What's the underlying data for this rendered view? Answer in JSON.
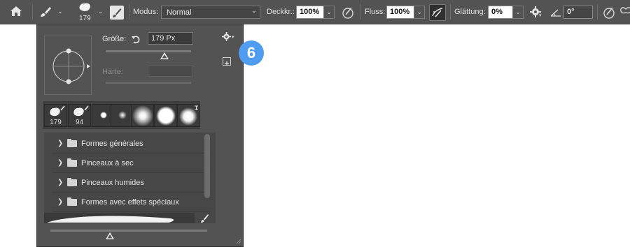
{
  "options_bar": {
    "mode_label": "Modus:",
    "mode_value": "Normal",
    "opacity_label": "Deckkr.:",
    "opacity_value": "100%",
    "flow_label": "Fluss:",
    "flow_value": "100%",
    "smoothing_label": "Glättung:",
    "smoothing_value": "0%",
    "angle_value": "0°",
    "brush_size_value": "179"
  },
  "brush_panel": {
    "size_label": "Größe:",
    "size_value": "179 Px",
    "hardness_label": "Härte:",
    "hardness_value": "",
    "recent_brushes": [
      {
        "label": "179"
      },
      {
        "label": "94"
      }
    ],
    "folders": [
      {
        "label": "Formes générales"
      },
      {
        "label": "Pinceaux à sec"
      },
      {
        "label": "Pinceaux humides"
      },
      {
        "label": "Formes avec effets spéciaux"
      }
    ]
  },
  "callout": {
    "number": "6"
  },
  "icons": [
    "home-icon",
    "brush-icon",
    "brush-settings-icon",
    "airbrush-icon",
    "pressure-opacity-icon",
    "gear-icon",
    "angle-icon",
    "pressure-size-icon",
    "butterfly-icon",
    "reset-icon",
    "new-preset-icon",
    "resize-grip-icon"
  ]
}
